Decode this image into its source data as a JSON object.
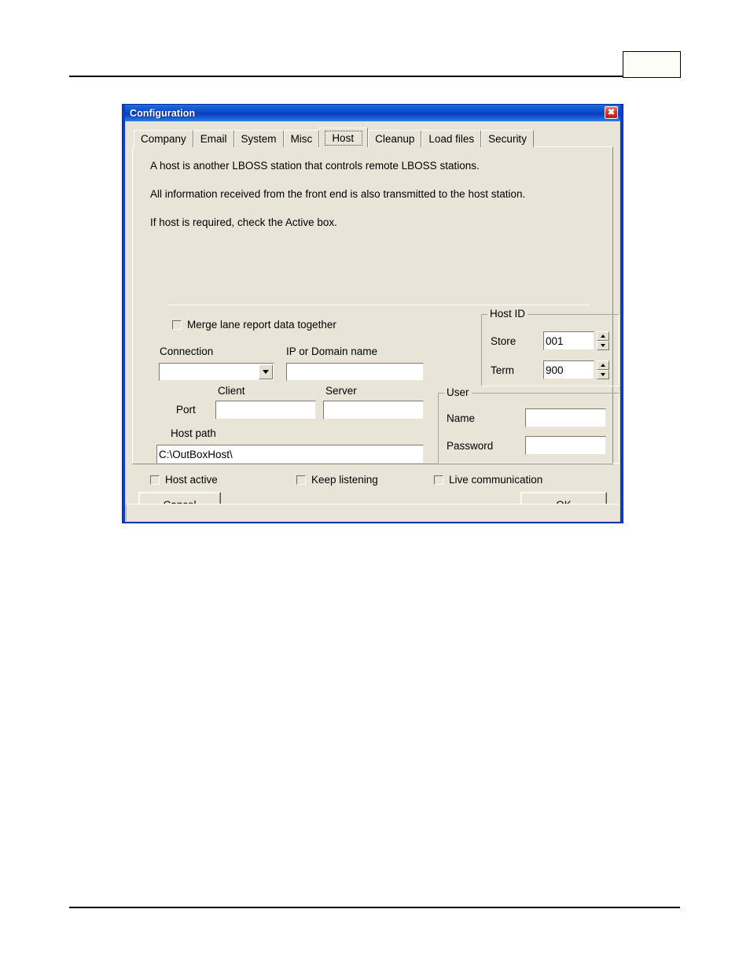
{
  "document": {
    "header_box_label": "",
    "has_header_rule": true,
    "has_footer_rule": true
  },
  "dialog": {
    "title": "Configuration",
    "close_icon": "close-icon",
    "close_glyph": "✖"
  },
  "tabs": {
    "items": [
      {
        "label": "Company",
        "selected": false
      },
      {
        "label": "Email",
        "selected": false
      },
      {
        "label": "System",
        "selected": false
      },
      {
        "label": "Misc",
        "selected": false
      },
      {
        "label": "Host",
        "selected": true
      },
      {
        "label": "Cleanup",
        "selected": false
      },
      {
        "label": "Load files",
        "selected": false
      },
      {
        "label": "Security",
        "selected": false
      }
    ]
  },
  "host_tab": {
    "description": [
      "A host is another LBOSS station that controls remote LBOSS stations.",
      "All information received from the front end is also transmitted to the host station.",
      "If host is required, check the Active box."
    ],
    "merge_checkbox": {
      "label": "Merge lane report data together",
      "checked": false
    },
    "connection": {
      "label": "Connection",
      "value": "",
      "dropdown_icon": "chevron-down-icon"
    },
    "ip_domain": {
      "label": "IP or Domain name",
      "value": ""
    },
    "port": {
      "label": "Port",
      "client_label": "Client",
      "client_value": "",
      "server_label": "Server",
      "server_value": ""
    },
    "host_path": {
      "label": "Host path",
      "value": "C:\\OutBoxHost\\"
    },
    "host_id_group": {
      "title": "Host ID",
      "store_label": "Store",
      "store_value": "001",
      "term_label": "Term",
      "term_value": "900"
    },
    "user_group": {
      "title": "User",
      "name_label": "Name",
      "name_value": "",
      "password_label": "Password",
      "password_value": ""
    },
    "checkboxes": [
      {
        "label": "Host active",
        "checked": false
      },
      {
        "label": "Keep listening",
        "checked": false
      },
      {
        "label": "Live communication",
        "checked": false
      }
    ]
  },
  "footer_buttons": {
    "cancel": "Cancel",
    "ok": "OK"
  },
  "colors": {
    "titlebar_blue": "#0a3fc4",
    "dialog_face": "#e8e5d8",
    "close_red": "#d63122",
    "field_white": "#ffffff"
  }
}
